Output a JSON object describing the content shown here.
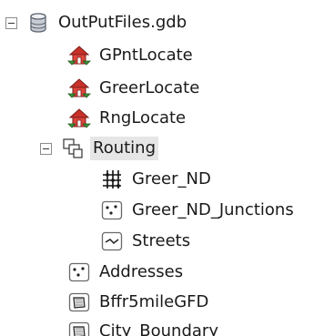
{
  "tree": {
    "items": [
      {
        "label": "OutPutFiles.gdb",
        "icon": "geodatabase-icon",
        "expanded": true
      },
      {
        "label": "GPntLocate",
        "icon": "address-locator-icon"
      },
      {
        "label": "GreerLocate",
        "icon": "address-locator-icon"
      },
      {
        "label": "RngLocate",
        "icon": "address-locator-icon"
      },
      {
        "label": "Routing",
        "icon": "feature-dataset-icon",
        "expanded": true
      },
      {
        "label": "Greer_ND",
        "icon": "network-dataset-icon"
      },
      {
        "label": "Greer_ND_Junctions",
        "icon": "point-feature-class-icon"
      },
      {
        "label": "Streets",
        "icon": "line-feature-class-icon"
      },
      {
        "label": "Addresses",
        "icon": "point-feature-class-icon"
      },
      {
        "label": "Bffr5mileGFD",
        "icon": "polygon-feature-class-icon"
      },
      {
        "label": "City_Boundary",
        "icon": "polygon-feature-class-icon"
      }
    ]
  },
  "colors": {
    "locator_red": "#c8302a",
    "locator_green": "#3f8f3a",
    "selection_bg": "#e6e6e6"
  }
}
